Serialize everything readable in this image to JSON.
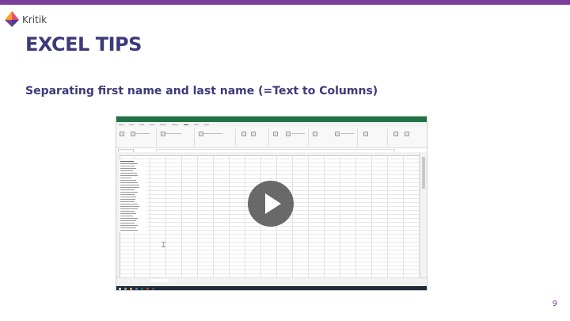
{
  "brand": {
    "name": "Kritik"
  },
  "slide": {
    "title": "EXCEL TIPS",
    "subtitle": "Separating first name and last name (=Text to Columns)",
    "page_number": "9"
  },
  "video": {
    "play_icon": "play-icon"
  },
  "colors": {
    "topbar": "#7a3e9d",
    "title": "#3d3a7a",
    "excel_green": "#217346"
  }
}
